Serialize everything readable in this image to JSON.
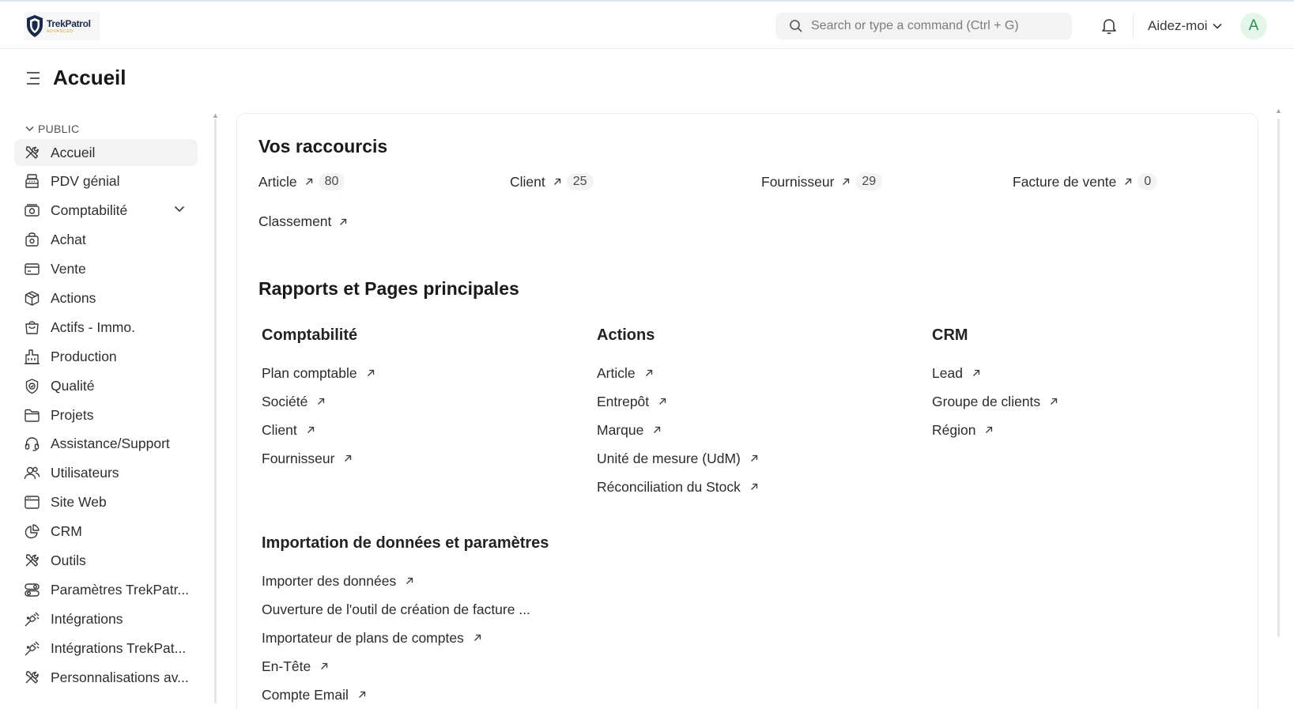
{
  "navbar": {
    "logo_name": "TrekPatrol",
    "logo_sub": "ADVANCED",
    "search_placeholder": "Search or type a command (Ctrl + G)",
    "help_label": "Aidez-moi",
    "avatar_letter": "A"
  },
  "page": {
    "title": "Accueil"
  },
  "sidebar": {
    "section_label": "PUBLIC",
    "items": [
      {
        "label": "Accueil",
        "icon": "tools-icon"
      },
      {
        "label": "PDV génial",
        "icon": "pos-register-icon"
      },
      {
        "label": "Comptabilité",
        "icon": "money-icon"
      },
      {
        "label": "Achat",
        "icon": "purchase-bag-icon"
      },
      {
        "label": "Vente",
        "icon": "sales-card-icon"
      },
      {
        "label": "Actions",
        "icon": "box-icon"
      },
      {
        "label": "Actifs - Immo.",
        "icon": "assets-bag-icon"
      },
      {
        "label": "Production",
        "icon": "factory-icon"
      },
      {
        "label": "Qualité",
        "icon": "quality-badge-icon"
      },
      {
        "label": "Projets",
        "icon": "folder-icon"
      },
      {
        "label": "Assistance/Support",
        "icon": "headset-icon"
      },
      {
        "label": "Utilisateurs",
        "icon": "users-icon"
      },
      {
        "label": "Site Web",
        "icon": "browser-icon"
      },
      {
        "label": "CRM",
        "icon": "pie-chart-icon"
      },
      {
        "label": "Outils",
        "icon": "tools-icon"
      },
      {
        "label": "Paramètres TrekPatr...",
        "icon": "settings-toggle-icon"
      },
      {
        "label": "Intégrations",
        "icon": "plug-icon"
      },
      {
        "label": "Intégrations TrekPat...",
        "icon": "plug-icon"
      },
      {
        "label": "Personnalisations av...",
        "icon": "tools-icon"
      }
    ]
  },
  "shortcuts": {
    "title": "Vos raccourcis",
    "items": [
      {
        "label": "Article",
        "count": "80"
      },
      {
        "label": "Client",
        "count": "25"
      },
      {
        "label": "Fournisseur",
        "count": "29"
      },
      {
        "label": "Facture de vente",
        "count": "0"
      },
      {
        "label": "Classement",
        "count": null
      }
    ]
  },
  "reports": {
    "title": "Rapports et Pages principales",
    "columns": [
      {
        "title": "Comptabilité",
        "links": [
          "Plan comptable",
          "Société",
          "Client",
          "Fournisseur"
        ]
      },
      {
        "title": "Actions",
        "links": [
          "Article",
          "Entrepôt",
          "Marque",
          "Unité de mesure (UdM)",
          "Réconciliation du Stock"
        ]
      },
      {
        "title": "CRM",
        "links": [
          "Lead",
          "Groupe de clients",
          "Région"
        ]
      }
    ],
    "import": {
      "title": "Importation de données et paramètres",
      "links": [
        {
          "label": "Importer des données",
          "external": true
        },
        {
          "label": "Ouverture de l'outil de création de facture ...",
          "external": false
        },
        {
          "label": "Importateur de plans de comptes",
          "external": true
        },
        {
          "label": "En-Tête",
          "external": true
        },
        {
          "label": "Compte Email",
          "external": true
        }
      ]
    }
  }
}
